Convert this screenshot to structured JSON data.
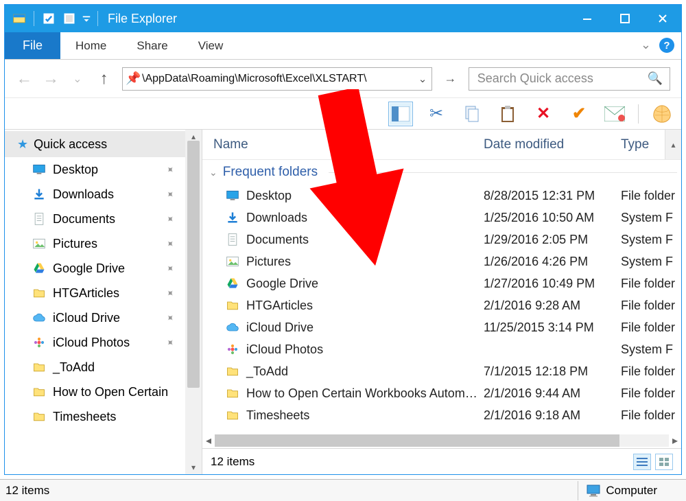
{
  "window": {
    "title": "File Explorer"
  },
  "ribbon": {
    "file": "File",
    "tabs": [
      "Home",
      "Share",
      "View"
    ]
  },
  "nav": {
    "path": "\\AppData\\Roaming\\Microsoft\\Excel\\XLSTART\\",
    "search_placeholder": "Search Quick access"
  },
  "sidebar": {
    "quick_access": "Quick access",
    "items": [
      {
        "label": "Desktop",
        "icon": "desktop",
        "pinned": true
      },
      {
        "label": "Downloads",
        "icon": "download",
        "pinned": true
      },
      {
        "label": "Documents",
        "icon": "doc",
        "pinned": true
      },
      {
        "label": "Pictures",
        "icon": "pic",
        "pinned": true
      },
      {
        "label": "Google Drive",
        "icon": "gdrive",
        "pinned": true
      },
      {
        "label": "HTGArticles",
        "icon": "folder",
        "pinned": true
      },
      {
        "label": "iCloud Drive",
        "icon": "icloud",
        "pinned": true
      },
      {
        "label": "iCloud Photos",
        "icon": "iphotos",
        "pinned": true
      },
      {
        "label": "_ToAdd",
        "icon": "folder",
        "pinned": false
      },
      {
        "label": "How to Open Certain",
        "icon": "folder",
        "pinned": false
      },
      {
        "label": "Timesheets",
        "icon": "folder",
        "pinned": false
      }
    ]
  },
  "columns": {
    "name": "Name",
    "date": "Date modified",
    "type": "Type"
  },
  "group_label": "Frequent folders",
  "rows": [
    {
      "name": "Desktop",
      "icon": "desktop",
      "date": "8/28/2015 12:31 PM",
      "type": "File folder"
    },
    {
      "name": "Downloads",
      "icon": "download",
      "date": "1/25/2016 10:50 AM",
      "type": "System F"
    },
    {
      "name": "Documents",
      "icon": "doc",
      "date": "1/29/2016 2:05 PM",
      "type": "System F"
    },
    {
      "name": "Pictures",
      "icon": "pic",
      "date": "1/26/2016 4:26 PM",
      "type": "System F"
    },
    {
      "name": "Google Drive",
      "icon": "gdrive",
      "date": "1/27/2016 10:49 PM",
      "type": "File folder"
    },
    {
      "name": "HTGArticles",
      "icon": "folder",
      "date": "2/1/2016 9:28 AM",
      "type": "File folder"
    },
    {
      "name": "iCloud Drive",
      "icon": "icloud",
      "date": "11/25/2015 3:14 PM",
      "type": "File folder"
    },
    {
      "name": "iCloud Photos",
      "icon": "iphotos",
      "date": "",
      "type": "System F"
    },
    {
      "name": "_ToAdd",
      "icon": "folder",
      "date": "7/1/2015 12:18 PM",
      "type": "File folder"
    },
    {
      "name": "How to Open Certain Workbooks Autom…",
      "icon": "folder",
      "date": "2/1/2016 9:44 AM",
      "type": "File folder"
    },
    {
      "name": "Timesheets",
      "icon": "folder",
      "date": "2/1/2016 9:18 AM",
      "type": "File folder"
    }
  ],
  "status": {
    "inner": "12 items",
    "outer": "12 items",
    "computer": "Computer"
  }
}
